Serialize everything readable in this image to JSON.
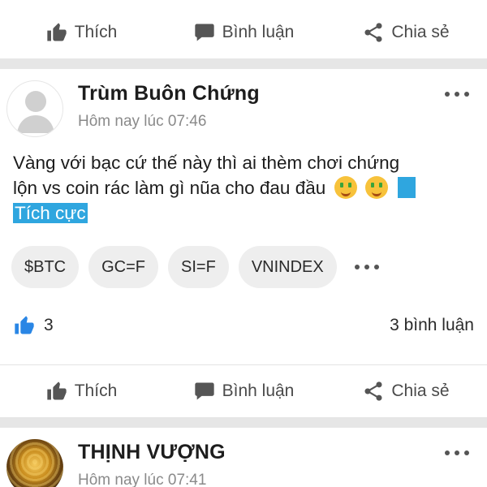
{
  "actions": {
    "like": "Thích",
    "comment": "Bình luận",
    "share": "Chia sẻ"
  },
  "post1": {
    "author": "Trùm Buôn Chứng",
    "time": "Hôm nay lúc 07:46",
    "content_line1": "Vàng với bạc cứ thế này thì ai thèm chơi chứng",
    "content_line2": "lộn vs coin rác làm gì nũa cho đau đầu",
    "highlight": "Tích cực",
    "tags": [
      "$BTC",
      "GC=F",
      "SI=F",
      "VNINDEX"
    ],
    "likes": "3",
    "comments": "3 bình luận"
  },
  "post2": {
    "author": "THỊNH VƯỢNG",
    "time": "Hôm nay lúc 07:41"
  },
  "colors": {
    "accent": "#2fa6df",
    "like_blue": "#2a86e5",
    "separator": "#e6e6e6"
  },
  "icons": {
    "like": "thumbs-up-icon",
    "comment": "speech-bubble-icon",
    "share": "share-icon",
    "more": "more-dots-icon"
  }
}
